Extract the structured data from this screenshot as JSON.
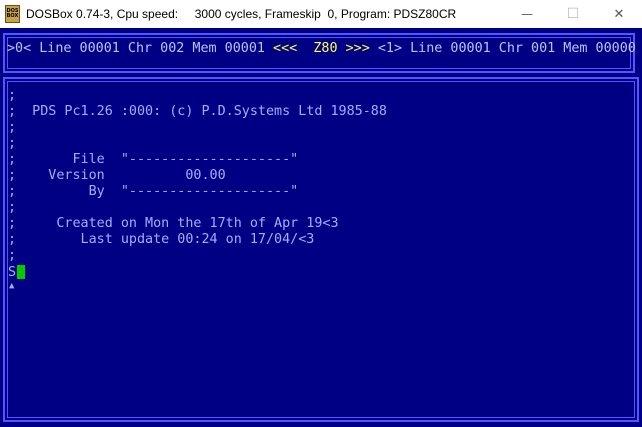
{
  "window": {
    "icon_line1": "DOS",
    "icon_line2": "BOX",
    "title": "DOSBox 0.74-3, Cpu speed:     3000 cycles, Frameskip  0, Program: PDSZ80CR",
    "controls": {
      "minimize": "—",
      "maximize": "☐",
      "close": "✕"
    }
  },
  "status": {
    "left": ">0< Line 00001 Chr 002 Mem 00001 ",
    "mid_open": "<<<  ",
    "cpu": "Z80",
    "mid_close": " >>>",
    "right": " <1> Line 00001 Chr 001 Mem 00000"
  },
  "editor": {
    "lines": [
      ";",
      ";  PDS Pc1.26 :000: (c) P.D.Systems Ltd 1985-88",
      ";",
      ";",
      ";       File  \"--------------------\"",
      ";    Version          00.00",
      ";         By  \"--------------------\"",
      ";",
      ";     Created on Mon the 17th of Apr 19<3",
      ";        Last update 00:24 on 17/04/<3",
      ";"
    ],
    "prompt": "S",
    "marker": "▲"
  },
  "colors": {
    "screen_bg": "#000084",
    "border": "#5555ff",
    "text": "#aaaaff",
    "highlight": "#ffff55",
    "cursor": "#00cc00"
  }
}
